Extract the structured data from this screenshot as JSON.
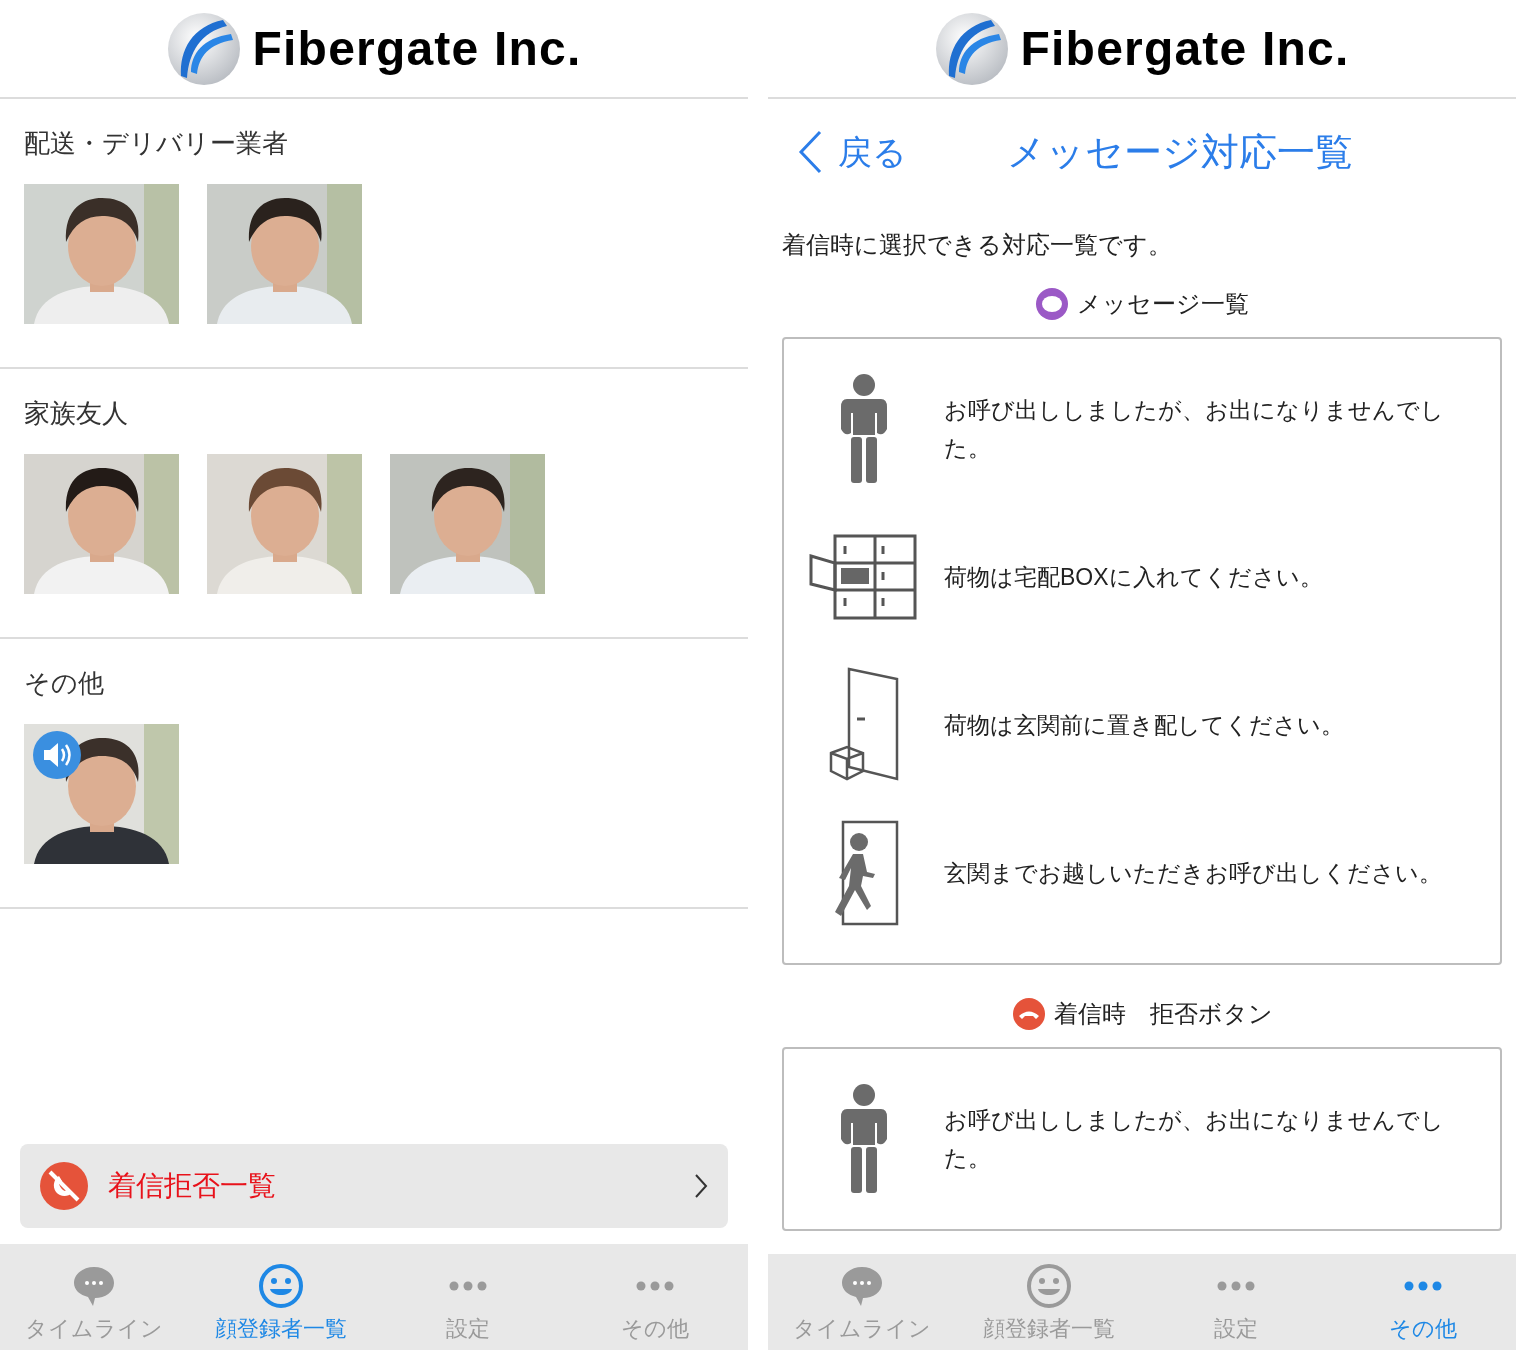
{
  "left": {
    "logo": "Fibergate Inc.",
    "groups": [
      {
        "title": "配送・デリバリー業者",
        "photos": [
          {
            "kind": "picture",
            "sound": false
          },
          {
            "kind": "picture",
            "sound": false
          }
        ]
      },
      {
        "title": "家族友人",
        "photos": [
          {
            "kind": "picture",
            "sound": false
          },
          {
            "kind": "picture",
            "sound": false
          },
          {
            "kind": "picture",
            "sound": false
          }
        ]
      },
      {
        "title": "その他",
        "photos": [
          {
            "kind": "picture",
            "sound": true
          }
        ]
      }
    ],
    "decline_link": {
      "label": "着信拒否一覧"
    },
    "tabs": [
      {
        "kind": "chat",
        "label": "タイムライン",
        "selected": false
      },
      {
        "kind": "face",
        "label": "顔登録者一覧",
        "selected": true
      },
      {
        "kind": "dots",
        "label": "設定",
        "selected": false
      },
      {
        "kind": "dots",
        "label": "その他",
        "selected": false
      }
    ]
  },
  "right": {
    "logo": "Fibergate Inc.",
    "back": "戻る",
    "title": "メッセージ対応一覧",
    "intro": "着信時に選択できる対応一覧です。",
    "sections": [
      {
        "kind": "message",
        "heading": "メッセージ一覧",
        "items": [
          {
            "kind": "bow",
            "text": "お呼び出ししましたが、お出になりませんでした。"
          },
          {
            "kind": "locker",
            "text": "荷物は宅配BOXに入れてください。"
          },
          {
            "kind": "door",
            "text": "荷物は玄関前に置き配してください。"
          },
          {
            "kind": "walk",
            "text": "玄関までお越しいただきお呼び出しください。"
          }
        ]
      },
      {
        "kind": "decline",
        "heading": "着信時　拒否ボタン",
        "items": [
          {
            "kind": "bow",
            "text": "お呼び出ししましたが、お出になりませんでした。"
          }
        ]
      }
    ],
    "tabs": [
      {
        "kind": "chat",
        "label": "タイムライン",
        "selected": false
      },
      {
        "kind": "face",
        "label": "顔登録者一覧",
        "selected": false
      },
      {
        "kind": "dots",
        "label": "設定",
        "selected": false
      },
      {
        "kind": "dots",
        "label": "その他",
        "selected": true
      }
    ]
  }
}
